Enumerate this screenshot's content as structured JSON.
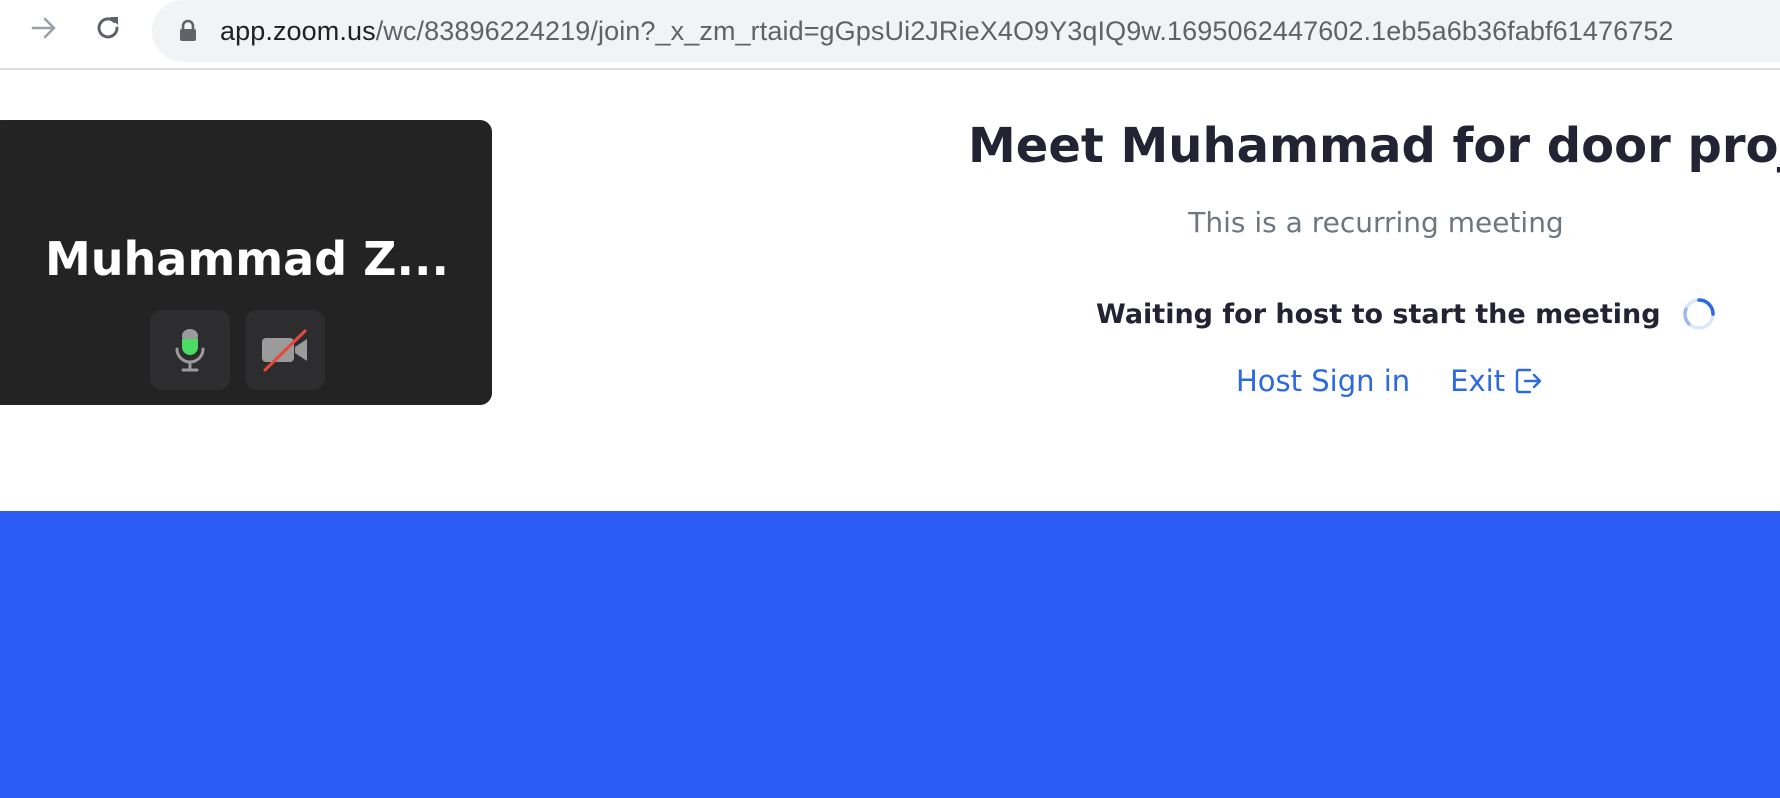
{
  "browser": {
    "url_host": "app.zoom.us",
    "url_path": "/wc/83896224219/join?_x_zm_rtaid=gGpsUi2JRieX4O9Y3qIQ9w.1695062447602.1eb5a6b36fabf61476752",
    "icons": [
      "forward-arrow-icon",
      "reload-icon",
      "lock-icon"
    ]
  },
  "preview": {
    "participant_name": "Muhammad Z...",
    "mic_state": "on",
    "camera_state": "off",
    "icons": [
      "microphone-icon",
      "video-off-icon"
    ]
  },
  "meeting": {
    "title": "Meet Muhammad for door project",
    "subtitle": "This is a recurring meeting",
    "status": "Waiting for host to start the meeting",
    "host_sign_in_label": "Host Sign in",
    "exit_label": "Exit"
  },
  "colors": {
    "blue_band": "#2b5cf6",
    "link": "#2d69e0",
    "tile_background": "#232323",
    "mic_active": "#4cd964",
    "camera_off_slash": "#e8493d"
  }
}
